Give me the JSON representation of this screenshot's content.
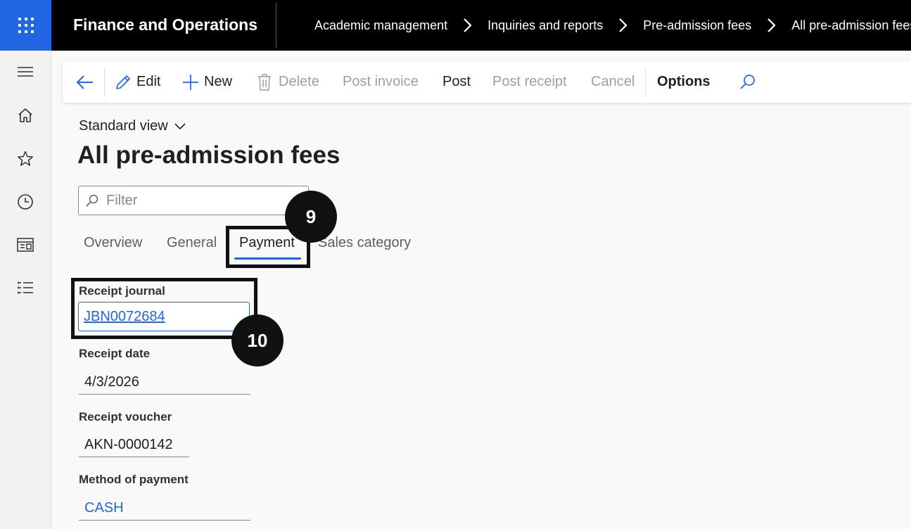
{
  "header": {
    "app_title": "Finance and Operations",
    "breadcrumb": [
      "Academic management",
      "Inquiries and reports",
      "Pre-admission fees",
      "All pre-admission fees"
    ]
  },
  "left_nav": {
    "icons": [
      "hamburger-icon",
      "home-icon",
      "star-icon",
      "clock-icon",
      "workspace-icon",
      "list-icon"
    ]
  },
  "action_pane": {
    "edit": "Edit",
    "new": "New",
    "delete": "Delete",
    "post_invoice": "Post invoice",
    "post": "Post",
    "post_receipt": "Post receipt",
    "cancel": "Cancel",
    "options": "Options"
  },
  "view": {
    "label": "Standard view"
  },
  "page": {
    "title": "All pre-admission fees"
  },
  "filter": {
    "placeholder": "Filter"
  },
  "tabs": [
    "Overview",
    "General",
    "Payment",
    "Sales category"
  ],
  "active_tab": "Payment",
  "fields": {
    "receipt_journal": {
      "label": "Receipt journal",
      "value": "JBN0072684"
    },
    "receipt_date": {
      "label": "Receipt date",
      "value": "4/3/2026"
    },
    "receipt_voucher": {
      "label": "Receipt voucher",
      "value": "AKN-0000142"
    },
    "method_of_payment": {
      "label": "Method of payment",
      "value": "CASH"
    }
  },
  "callouts": [
    "9",
    "10"
  ],
  "colors": {
    "accent": "#2266e3",
    "topbar": "#000000",
    "disabled": "#a19f9d"
  }
}
